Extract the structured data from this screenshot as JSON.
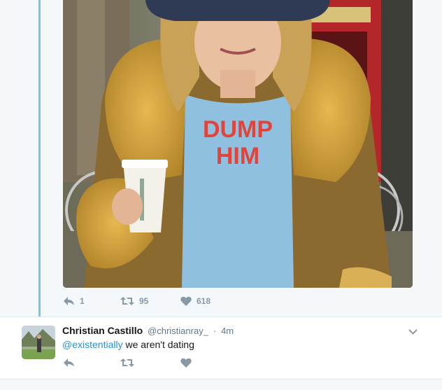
{
  "main_tweet": {
    "photo": {
      "shirt_text_line1": "DUMP",
      "shirt_text_line2": "HIM"
    },
    "actions": {
      "reply_count": "1",
      "retweet_count": "95",
      "like_count": "618"
    }
  },
  "reply_tweet": {
    "author_name": "Christian Castillo",
    "author_handle": "@christianray_",
    "separator": "·",
    "timestamp": "4m",
    "mention": "@existentially",
    "text": " we aren't dating"
  },
  "colors": {
    "thread_line": "#7fc3de",
    "link": "#1b95e0",
    "muted": "#8899a6",
    "background": "#f5f8fa"
  },
  "icons": [
    "reply-icon",
    "retweet-icon",
    "like-icon",
    "chevron-down-icon"
  ]
}
